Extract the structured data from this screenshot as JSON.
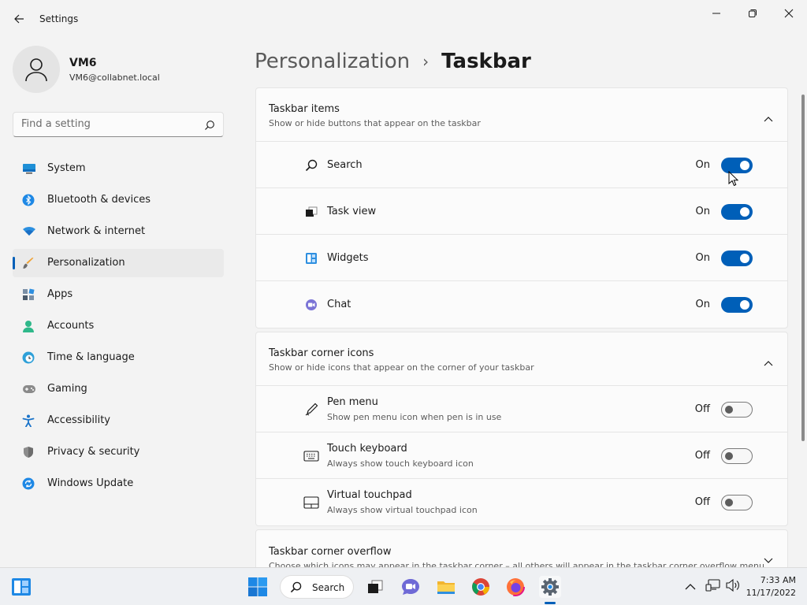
{
  "window": {
    "title": "Settings"
  },
  "profile": {
    "name": "VM6",
    "email": "VM6@collabnet.local"
  },
  "search": {
    "placeholder": "Find a setting"
  },
  "sidebar": {
    "items": [
      {
        "label": "System",
        "icon": "system-icon",
        "active": false
      },
      {
        "label": "Bluetooth & devices",
        "icon": "bluetooth-icon",
        "active": false
      },
      {
        "label": "Network & internet",
        "icon": "wifi-icon",
        "active": false
      },
      {
        "label": "Personalization",
        "icon": "brush-icon",
        "active": true
      },
      {
        "label": "Apps",
        "icon": "apps-icon",
        "active": false
      },
      {
        "label": "Accounts",
        "icon": "accounts-icon",
        "active": false
      },
      {
        "label": "Time & language",
        "icon": "time-language-icon",
        "active": false
      },
      {
        "label": "Gaming",
        "icon": "gaming-icon",
        "active": false
      },
      {
        "label": "Accessibility",
        "icon": "accessibility-icon",
        "active": false
      },
      {
        "label": "Privacy & security",
        "icon": "shield-icon",
        "active": false
      },
      {
        "label": "Windows Update",
        "icon": "windows-update-icon",
        "active": false
      }
    ]
  },
  "breadcrumb": {
    "parent": "Personalization",
    "separator": "›",
    "current": "Taskbar"
  },
  "sections": {
    "taskbar_items": {
      "title": "Taskbar items",
      "subtitle": "Show or hide buttons that appear on the taskbar",
      "expanded": true,
      "rows": [
        {
          "label": "Search",
          "icon": "search-icon",
          "state": "On",
          "on": true
        },
        {
          "label": "Task view",
          "icon": "task-view-icon",
          "state": "On",
          "on": true
        },
        {
          "label": "Widgets",
          "icon": "widgets-icon",
          "state": "On",
          "on": true
        },
        {
          "label": "Chat",
          "icon": "chat-icon",
          "state": "On",
          "on": true
        }
      ]
    },
    "corner_icons": {
      "title": "Taskbar corner icons",
      "subtitle": "Show or hide icons that appear on the corner of your taskbar",
      "expanded": true,
      "rows": [
        {
          "label": "Pen menu",
          "sub": "Show pen menu icon when pen is in use",
          "icon": "pen-icon",
          "state": "Off",
          "on": false
        },
        {
          "label": "Touch keyboard",
          "sub": "Always show touch keyboard icon",
          "icon": "keyboard-icon",
          "state": "Off",
          "on": false
        },
        {
          "label": "Virtual touchpad",
          "sub": "Always show virtual touchpad icon",
          "icon": "touchpad-icon",
          "state": "Off",
          "on": false
        }
      ]
    },
    "corner_overflow": {
      "title": "Taskbar corner overflow",
      "subtitle": "Choose which icons may appear in the taskbar corner – all others will appear in the taskbar corner overflow menu",
      "expanded": false
    }
  },
  "taskbar": {
    "search_label": "Search",
    "time": "7:33 AM",
    "date": "11/17/2022"
  },
  "colors": {
    "accent": "#005fb8",
    "background": "#f3f3f3",
    "card": "#fbfbfb"
  }
}
